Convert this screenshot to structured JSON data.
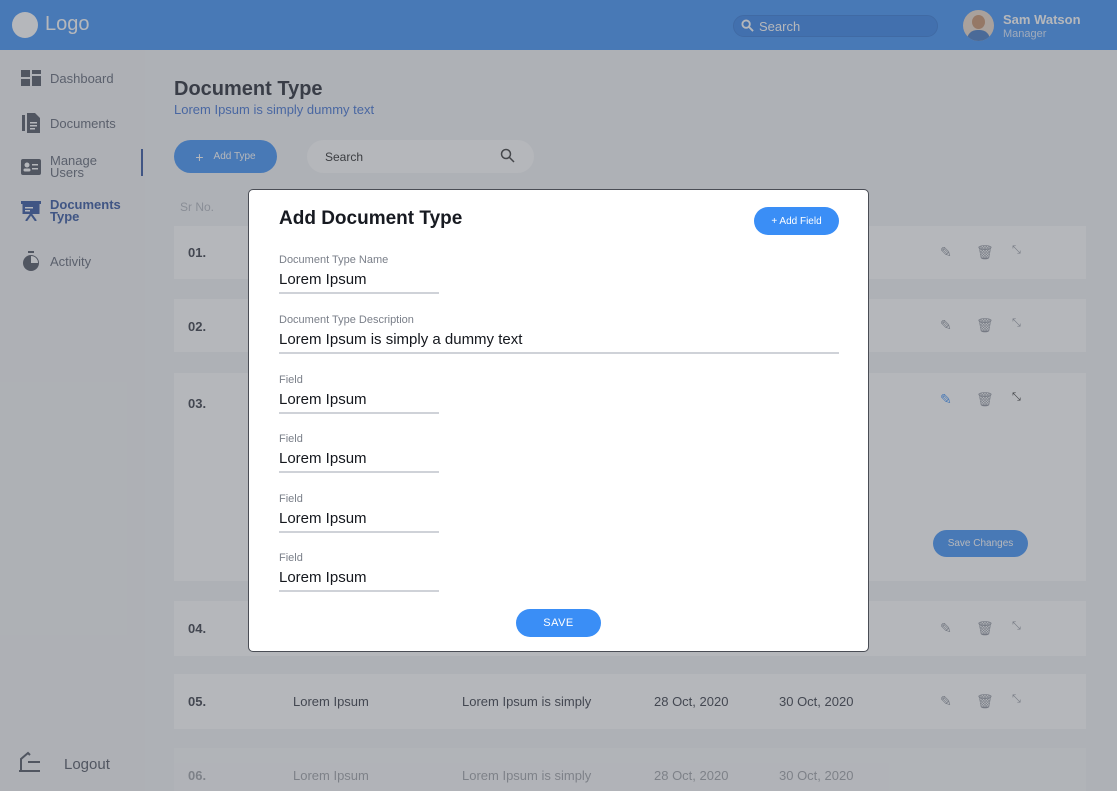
{
  "header": {
    "logo": "Logo",
    "search_placeholder": "Search",
    "user_name": "Sam Watson",
    "user_role": "Manager"
  },
  "sidebar": {
    "items": [
      {
        "label": "Dashboard"
      },
      {
        "label": "Documents"
      },
      {
        "label": "Manage\nUsers"
      },
      {
        "label": "Documents\nType",
        "active": true
      },
      {
        "label": "Activity"
      }
    ],
    "logout": "Logout"
  },
  "main": {
    "title": "Document Type",
    "subtitle": "Lorem Ipsum is simply dummy text",
    "add_type_label": "Add Type",
    "search_placeholder": "Search",
    "col_sr_no": "Sr No.",
    "rows": [
      {
        "num": "01."
      },
      {
        "num": "02."
      },
      {
        "num": "03.",
        "save_changes": "Save Changes"
      },
      {
        "num": "04."
      },
      {
        "num": "05.",
        "name": "Lorem Ipsum",
        "desc": "Lorem Ipsum is simply",
        "created": "28 Oct, 2020",
        "updated": "30 Oct, 2020"
      },
      {
        "num": "06.",
        "name": "Lorem Ipsum",
        "desc": "Lorem Ipsum is simply",
        "created": "28 Oct, 2020",
        "updated": "30 Oct, 2020"
      }
    ]
  },
  "modal": {
    "title": "Add Document Type",
    "add_field_label": "+ Add Field",
    "fields": [
      {
        "label": "Document Type Name",
        "value": "Lorem Ipsum"
      },
      {
        "label": "Document Type Description",
        "value": "Lorem Ipsum is simply a dummy text"
      },
      {
        "label": "Field",
        "value": "Lorem Ipsum"
      },
      {
        "label": "Field",
        "value": "Lorem Ipsum"
      },
      {
        "label": "Field",
        "value": "Lorem Ipsum"
      },
      {
        "label": "Field",
        "value": "Lorem Ipsum"
      }
    ],
    "save_label": "SAVE"
  },
  "colors": {
    "primary": "#3a8ef6",
    "active_nav": "#2a4e9b"
  }
}
